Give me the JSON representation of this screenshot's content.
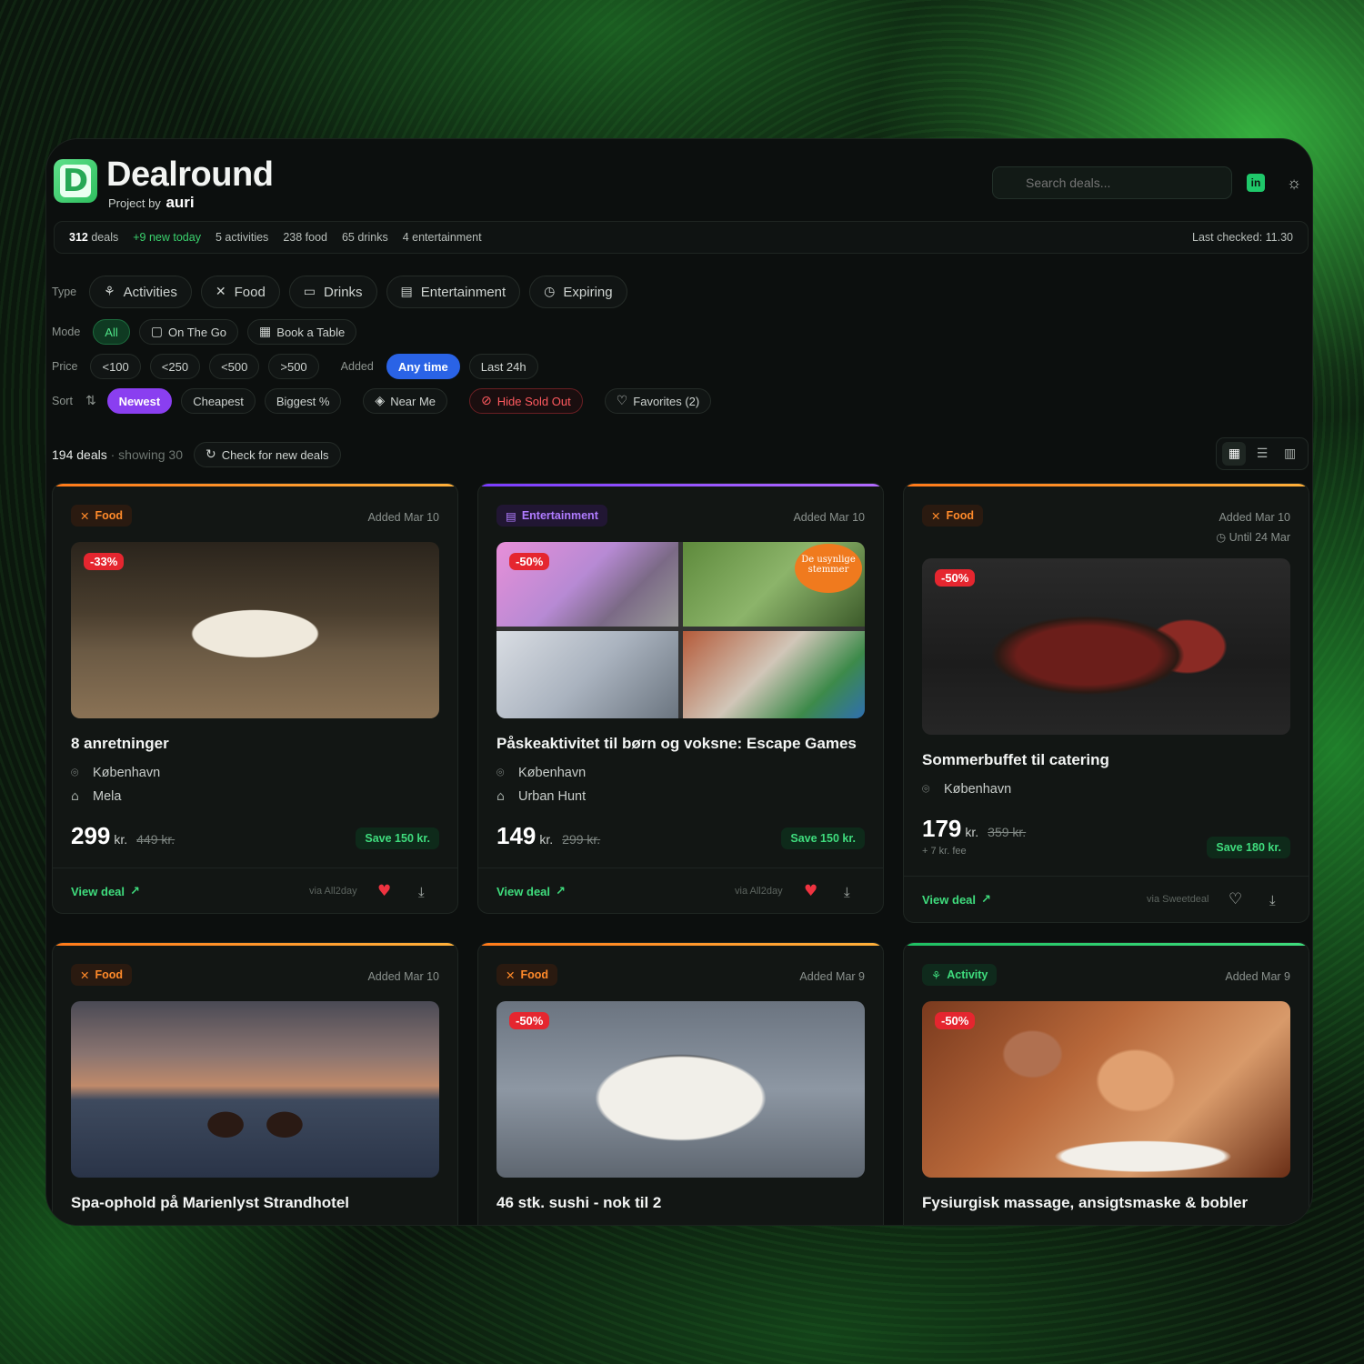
{
  "app": {
    "logo_letter": "D",
    "name": "Dealround",
    "byline_prefix": "Project by",
    "byline_brand": "auri",
    "search_placeholder": "Search deals..."
  },
  "stats": {
    "deals_count": "312",
    "deals_label": "deals",
    "new_today": "+9 new today",
    "activities": "5 activities",
    "food": "238 food",
    "drinks": "65 drinks",
    "entertainment": "4 entertainment",
    "last_checked": "Last checked: 11.30"
  },
  "filters": {
    "type_label": "Type",
    "types": [
      "Activities",
      "Food",
      "Drinks",
      "Entertainment",
      "Expiring"
    ],
    "mode_label": "Mode",
    "modes": [
      "All",
      "On The Go",
      "Book a Table"
    ],
    "price_label": "Price",
    "prices": [
      "<100",
      "<250",
      "<500",
      ">500"
    ],
    "added_label": "Added",
    "added": [
      "Any time",
      "Last 24h"
    ],
    "sort_label": "Sort",
    "sorts": [
      "Newest",
      "Cheapest",
      "Biggest %"
    ],
    "near_me": "Near Me",
    "hide_sold_out": "Hide Sold Out",
    "favorites": "Favorites (2)"
  },
  "list": {
    "count": "194 deals",
    "showing": "· showing 30",
    "refresh": "Check for new deals"
  },
  "colors": {
    "food": "#ff8a2a",
    "entertainment": "#9b5cff",
    "activity": "#2fd06e",
    "save": "#3fdc7d",
    "discount": "#e5262f"
  },
  "cards": [
    {
      "category": "Food",
      "added": "Added Mar 10",
      "discount": "-33%",
      "title": "8 anretninger",
      "location": "København",
      "venue": "Mela",
      "price": "299",
      "currency": "kr.",
      "old_price": "449 kr.",
      "save": "Save 150 kr.",
      "view": "View deal",
      "via": "via All2day",
      "favorite": true
    },
    {
      "category": "Entertainment",
      "added": "Added Mar 10",
      "discount": "-50%",
      "title": "Påskeaktivitet til børn og voksne: Escape Games",
      "location": "København",
      "venue": "Urban Hunt",
      "price": "149",
      "currency": "kr.",
      "old_price": "299 kr.",
      "save": "Save 150 kr.",
      "view": "View deal",
      "via": "via All2day",
      "favorite": true,
      "image_text": "De usynlige stemmer"
    },
    {
      "category": "Food",
      "added": "Added Mar 10",
      "until": "Until 24 Mar",
      "discount": "-50%",
      "title": "Sommerbuffet til catering",
      "location": "København",
      "price": "179",
      "currency": "kr.",
      "old_price": "359 kr.",
      "fee": "+ 7 kr. fee",
      "save": "Save 180 kr.",
      "view": "View deal",
      "via": "via Sweetdeal",
      "favorite": false
    },
    {
      "category": "Food",
      "added": "Added Mar 10",
      "title": "Spa-ophold på Marienlyst Strandhotel"
    },
    {
      "category": "Food",
      "added": "Added Mar 9",
      "discount": "-50%",
      "title": "46 stk. sushi - nok til 2"
    },
    {
      "category": "Activity",
      "added": "Added Mar 9",
      "discount": "-50%",
      "title": "Fysiurgisk massage, ansigtsmaske & bobler"
    }
  ]
}
